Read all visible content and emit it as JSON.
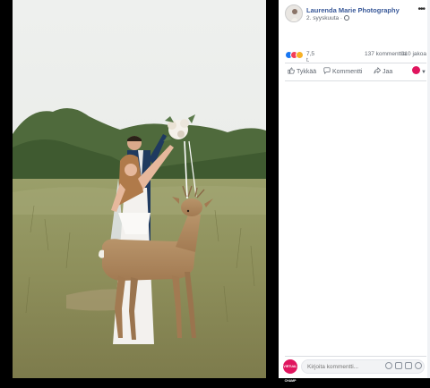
{
  "post": {
    "page_name": "Laurenda Marie Photography",
    "date": "2. syyskuuta ·"
  },
  "stats": {
    "reactions": "7,5 t.",
    "comments": "137 kommenttia",
    "shares": "110 jakoa"
  },
  "actions": {
    "like": "Tykkää",
    "comment": "Kommentti",
    "share": "Jaa"
  },
  "comment_box": {
    "placeholder": "Kirjoita kommentti...",
    "avatar_text": "VIRTUAL CHAMP"
  },
  "icons": {
    "more": "more-options-icon",
    "globe": "globe-icon",
    "like": "thumbs-up-icon",
    "comment": "speech-bubble-icon",
    "share": "share-arrow-icon",
    "emoji": "emoji-icon",
    "camera": "camera-icon",
    "gif": "gif-icon",
    "sticker": "sticker-icon"
  },
  "colors": {
    "link": "#385898",
    "like": "#1877f2",
    "love": "#f33e58",
    "haha": "#f7b125",
    "avatar": "#e0155e"
  }
}
